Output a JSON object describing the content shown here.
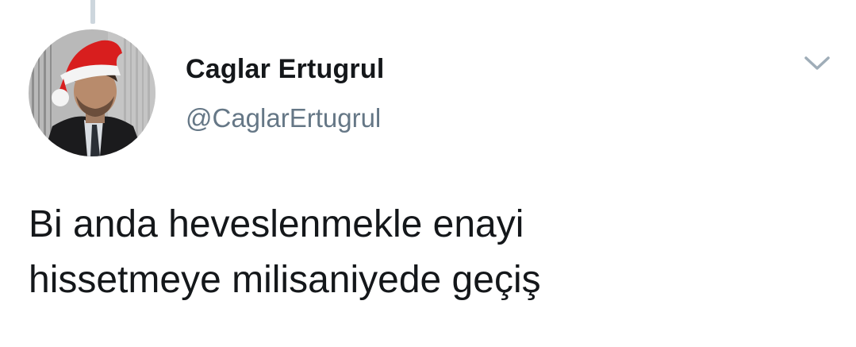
{
  "tweet": {
    "author": {
      "display_name": "Caglar Ertugrul",
      "username": "@CaglarErtugrul",
      "avatar_icon": "profile-photo-santa-hat"
    },
    "menu_icon": "chevron-down-icon",
    "text_lines": [
      "Bi anda heveslenmekle enayi",
      "hissetmeye milisaniyede geçiş"
    ]
  },
  "colors": {
    "name": "#14171a",
    "handle": "#657786",
    "thread_line": "#cdd6dd",
    "caret": "#9fadb8",
    "hat_red": "#d81e1e"
  }
}
